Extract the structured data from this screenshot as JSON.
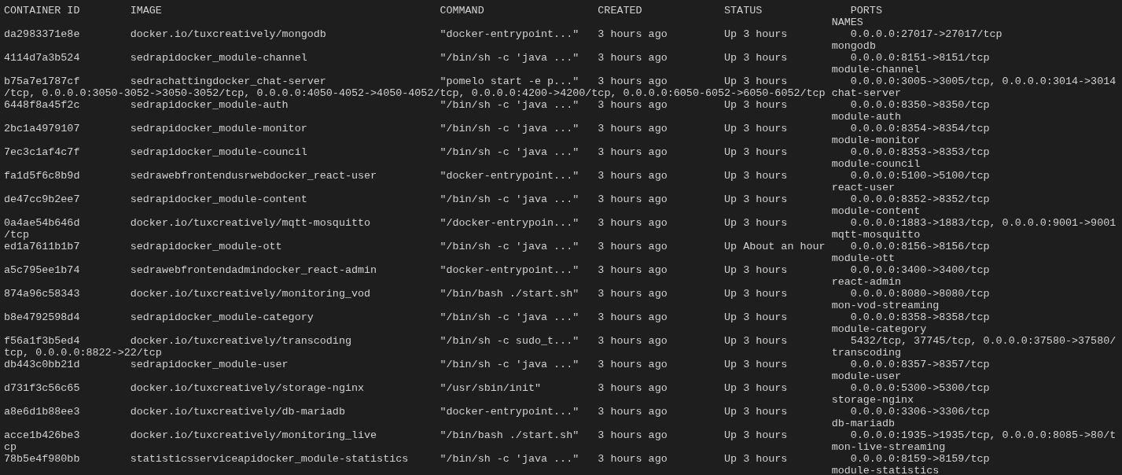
{
  "header": {
    "columns": [
      "CONTAINER ID",
      "IMAGE",
      "COMMAND",
      "CREATED",
      "STATUS",
      "PORTS"
    ],
    "names_column": "NAMES"
  },
  "containers": [
    {
      "id": "da2983371e8e",
      "image": "docker.io/tuxcreatively/mongodb",
      "command": "\"docker-entrypoint...\"",
      "created": "3 hours ago",
      "status": "Up 3 hours",
      "ports": "0.0.0.0:27017->27017/tcp",
      "name": "mongodb"
    },
    {
      "id": "4114d7a3b524",
      "image": "sedrapidocker_module-channel",
      "command": "\"/bin/sh -c 'java ...\"",
      "created": "3 hours ago",
      "status": "Up 3 hours",
      "ports": "0.0.0.0:8151->8151/tcp",
      "name": "module-channel"
    },
    {
      "id": "b75a7e1787cf",
      "image": "sedrachattingdocker_chat-server",
      "command": "\"pomelo start -e p...\"",
      "created": "3 hours ago",
      "status": "Up 3 hours",
      "ports": "0.0.0.0:3005->3005/tcp, 0.0.0.0:3014->3014",
      "ports_wrapped": "/tcp, 0.0.0.0:3050-3052->3050-3052/tcp, 0.0.0.0:4050-4052->4050-4052/tcp, 0.0.0.0:4200->4200/tcp, 0.0.0.0:6050-6052->6050-6052/tcp",
      "name": "chat-server"
    },
    {
      "id": "6448f8a45f2c",
      "image": "sedrapidocker_module-auth",
      "command": "\"/bin/sh -c 'java ...\"",
      "created": "3 hours ago",
      "status": "Up 3 hours",
      "ports": "0.0.0.0:8350->8350/tcp",
      "name": "module-auth"
    },
    {
      "id": "2bc1a4979107",
      "image": "sedrapidocker_module-monitor",
      "command": "\"/bin/sh -c 'java ...\"",
      "created": "3 hours ago",
      "status": "Up 3 hours",
      "ports": "0.0.0.0:8354->8354/tcp",
      "name": "module-monitor"
    },
    {
      "id": "7ec3c1af4c7f",
      "image": "sedrapidocker_module-council",
      "command": "\"/bin/sh -c 'java ...\"",
      "created": "3 hours ago",
      "status": "Up 3 hours",
      "ports": "0.0.0.0:8353->8353/tcp",
      "name": "module-council"
    },
    {
      "id": "fa1d5f6c8b9d",
      "image": "sedrawebfrontendusrwebdocker_react-user",
      "command": "\"docker-entrypoint...\"",
      "created": "3 hours ago",
      "status": "Up 3 hours",
      "ports": "0.0.0.0:5100->5100/tcp",
      "name": "react-user"
    },
    {
      "id": "de47cc9b2ee7",
      "image": "sedrapidocker_module-content",
      "command": "\"/bin/sh -c 'java ...\"",
      "created": "3 hours ago",
      "status": "Up 3 hours",
      "ports": "0.0.0.0:8352->8352/tcp",
      "name": "module-content"
    },
    {
      "id": "0a4ae54b646d",
      "image": "docker.io/tuxcreatively/mqtt-mosquitto",
      "command": "\"/docker-entrypoin...\"",
      "created": "3 hours ago",
      "status": "Up 3 hours",
      "ports": "0.0.0.0:1883->1883/tcp, 0.0.0.0:9001->9001",
      "ports_wrapped": "/tcp",
      "name": "mqtt-mosquitto"
    },
    {
      "id": "ed1a7611b1b7",
      "image": "sedrapidocker_module-ott",
      "command": "\"/bin/sh -c 'java ...\"",
      "created": "3 hours ago",
      "status": "Up About an hour",
      "ports": "0.0.0.0:8156->8156/tcp",
      "name": "module-ott"
    },
    {
      "id": "a5c795ee1b74",
      "image": "sedrawebfrontendadmindocker_react-admin",
      "command": "\"docker-entrypoint...\"",
      "created": "3 hours ago",
      "status": "Up 3 hours",
      "ports": "0.0.0.0:3400->3400/tcp",
      "name": "react-admin"
    },
    {
      "id": "874a96c58343",
      "image": "docker.io/tuxcreatively/monitoring_vod",
      "command": "\"/bin/bash ./start.sh\"",
      "created": "3 hours ago",
      "status": "Up 3 hours",
      "ports": "0.0.0.0:8080->8080/tcp",
      "name": "mon-vod-streaming"
    },
    {
      "id": "b8e4792598d4",
      "image": "sedrapidocker_module-category",
      "command": "\"/bin/sh -c 'java ...\"",
      "created": "3 hours ago",
      "status": "Up 3 hours",
      "ports": "0.0.0.0:8358->8358/tcp",
      "name": "module-category"
    },
    {
      "id": "f56a1f3b5ed4",
      "image": "docker.io/tuxcreatively/transcoding",
      "command": "\"/bin/sh -c sudo_t...\"",
      "created": "3 hours ago",
      "status": "Up 3 hours",
      "ports": "5432/tcp, 37745/tcp, 0.0.0.0:37580->37580/",
      "ports_wrapped": "tcp, 0.0.0.0:8822->22/tcp",
      "name": "transcoding"
    },
    {
      "id": "db443c0bb21d",
      "image": "sedrapidocker_module-user",
      "command": "\"/bin/sh -c 'java ...\"",
      "created": "3 hours ago",
      "status": "Up 3 hours",
      "ports": "0.0.0.0:8357->8357/tcp",
      "name": "module-user"
    },
    {
      "id": "d731f3c56c65",
      "image": "docker.io/tuxcreatively/storage-nginx",
      "command": "\"/usr/sbin/init\"",
      "created": "3 hours ago",
      "status": "Up 3 hours",
      "ports": "0.0.0.0:5300->5300/tcp",
      "name": "storage-nginx"
    },
    {
      "id": "a8e6d1b88ee3",
      "image": "docker.io/tuxcreatively/db-mariadb",
      "command": "\"docker-entrypoint...\"",
      "created": "3 hours ago",
      "status": "Up 3 hours",
      "ports": "0.0.0.0:3306->3306/tcp",
      "name": "db-mariadb"
    },
    {
      "id": "acce1b426be3",
      "image": "docker.io/tuxcreatively/monitoring_live",
      "command": "\"/bin/bash ./start.sh\"",
      "created": "3 hours ago",
      "status": "Up 3 hours",
      "ports": "0.0.0.0:1935->1935/tcp, 0.0.0.0:8085->80/t",
      "ports_wrapped": "cp",
      "name": "mon-live-streaming"
    },
    {
      "id": "78b5e4f980bb",
      "image": "statisticsserviceapidocker_module-statistics",
      "command": "\"/bin/sh -c 'java ...\"",
      "created": "3 hours ago",
      "status": "Up 3 hours",
      "ports": "0.0.0.0:8159->8159/tcp",
      "name": "module-statistics"
    }
  ]
}
